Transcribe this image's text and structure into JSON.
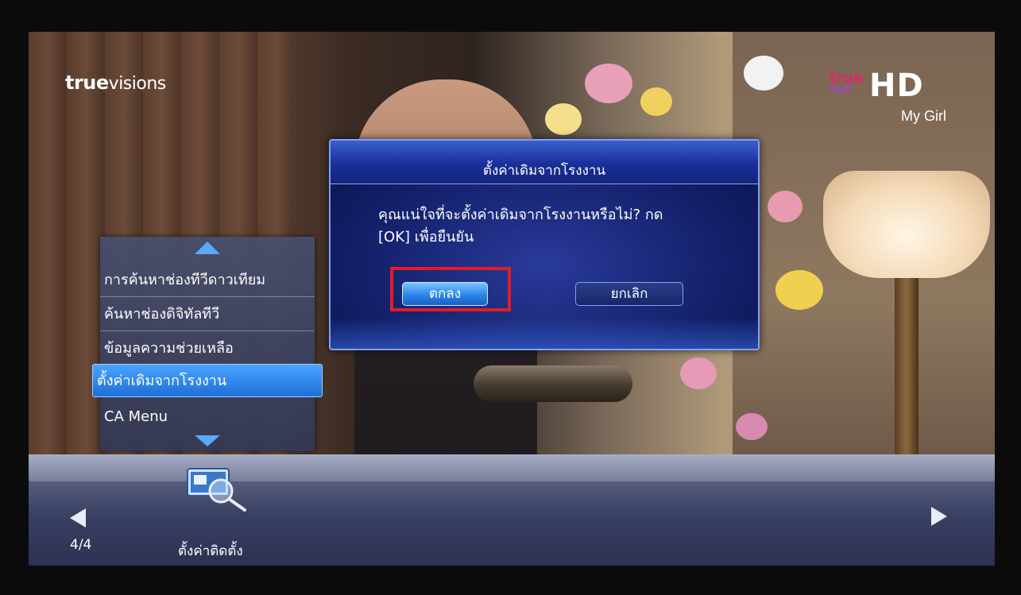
{
  "brand": {
    "part1": "true",
    "part2": "visions"
  },
  "channel": {
    "logo_top": "true",
    "logo_bottom": "FILM",
    "logo_hd": "HD",
    "program_name": "My Girl"
  },
  "side_menu": {
    "items": [
      {
        "label": "การค้นหาช่องทีวีดาวเทียม"
      },
      {
        "label": "ค้นหาช่องดิจิทัลทีวี"
      },
      {
        "label": "ข้อมูลความช่วยเหลือ"
      },
      {
        "label": "ตั้งค่าเดิมจากโรงงาน",
        "selected": true
      },
      {
        "label": "CA Menu"
      }
    ]
  },
  "dialog": {
    "title": "ตั้งค่าเดิมจากโรงงาน",
    "message_line1": "คุณแน่ใจที่จะตั้งค่าเดิมจากโรงงานหรือไม่? กด",
    "message_line2": "[OK] เพื่อยืนยัน",
    "ok_label": "ตกลง",
    "cancel_label": "ยกเลิก"
  },
  "bottom_bar": {
    "page_counter": "4/4",
    "current_section": "ตั้งค่าติดตั้ง"
  },
  "colors": {
    "highlight": "#e51c23",
    "selected_item": "#2a86e8",
    "dialog_bg": "#13206a"
  }
}
